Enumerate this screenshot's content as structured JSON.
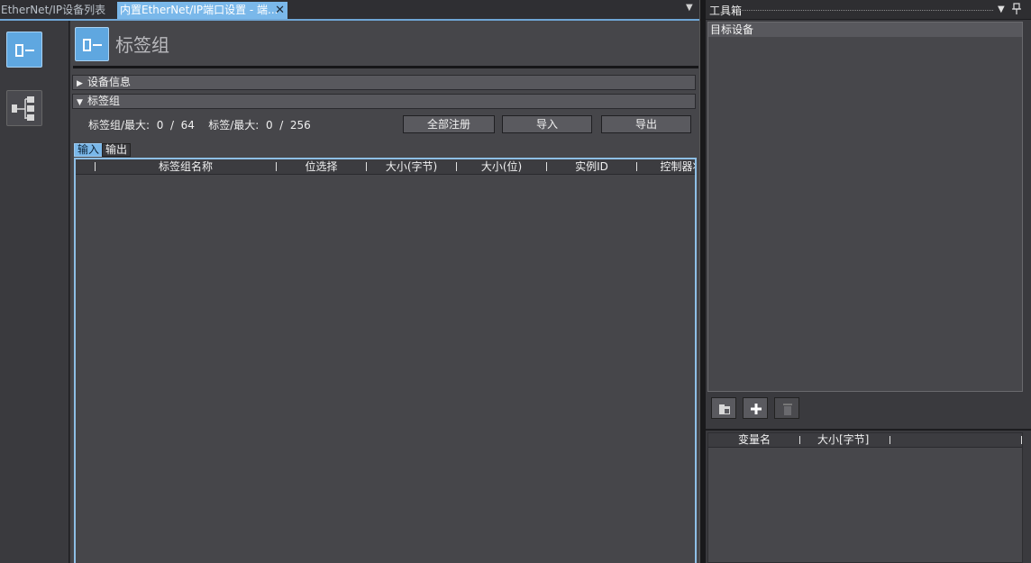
{
  "tabs": {
    "list_label": "EtherNet/IP设备列表",
    "active_label": "内置EtherNet/IP端口设置 - 端...",
    "close_glyph": "✕",
    "menu_glyph": "▼"
  },
  "nav": {
    "tag_group_icon": "tag-group-icon",
    "connection_icon": "connection-tree-icon"
  },
  "page": {
    "title": "标签组",
    "sections": {
      "device_info": "设备信息",
      "tag_group": "标签组"
    },
    "carets": {
      "collapsed": "▶",
      "expanded": "▼"
    },
    "counts": {
      "group_label": "标签组/最大:",
      "group_value": "0  /  64",
      "tag_label": "标签/最大:",
      "tag_value": "0  /  256"
    },
    "buttons": {
      "register_all": "全部注册",
      "import": "导入",
      "export": "导出"
    },
    "subtabs": {
      "input": "输入",
      "output": "输出"
    },
    "grid_columns": [
      "标签组名称",
      "位选择",
      "大小(字节)",
      "大小(位)",
      "实例ID",
      "控制器状"
    ]
  },
  "toolbox": {
    "title": "工具箱",
    "down_glyph": "▼",
    "pin_glyph": "📌",
    "target_device": "目标设备",
    "buttons": {
      "folder": "folder-icon",
      "add": "+",
      "delete": "trash-icon"
    },
    "columns": [
      "变量名",
      "大小[字节]"
    ]
  },
  "colors": {
    "accent": "#7ab8ea",
    "panel": "#46464a",
    "header": "#58585d"
  }
}
